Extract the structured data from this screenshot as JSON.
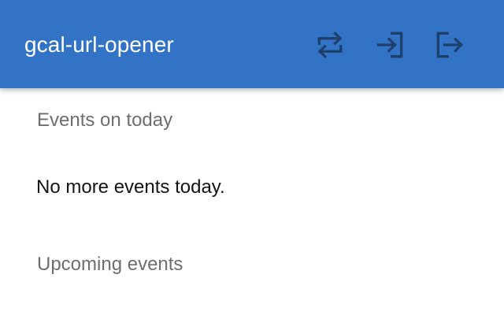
{
  "app_bar": {
    "title": "gcal-url-opener",
    "background_color": "#3273c5",
    "icon_color": "#1d3f6a",
    "actions": [
      {
        "icon": "sync-icon"
      },
      {
        "icon": "login-icon"
      },
      {
        "icon": "logout-icon"
      }
    ]
  },
  "today_section": {
    "header": "Events on today",
    "empty_message": "No more events today."
  },
  "upcoming_section": {
    "header": "Upcoming events"
  }
}
